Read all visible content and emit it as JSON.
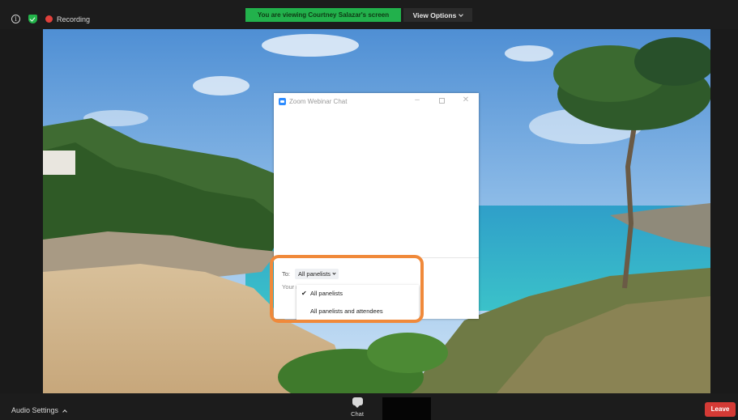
{
  "topbar": {
    "recording_label": "Recording",
    "viewing_banner": "You are viewing Courtney Salazar's screen",
    "view_options_label": "View Options"
  },
  "chat_window": {
    "title": "Zoom Webinar Chat",
    "to_label": "To:",
    "to_selected": "All panelists",
    "input_placeholder": "Your message here...",
    "dropdown_options": [
      {
        "label": "All panelists",
        "checked": true
      },
      {
        "label": "All panelists and attendees",
        "checked": false
      }
    ]
  },
  "bottombar": {
    "audio_settings_label": "Audio Settings",
    "chat_label": "Chat",
    "leave_label": "Leave"
  },
  "colors": {
    "banner_green": "#22b14c",
    "leave_red": "#d43a35",
    "highlight_orange": "#f0893a",
    "zoom_blue": "#2d8cff"
  },
  "icons": [
    "info-icon",
    "shield-check-icon",
    "record-icon",
    "chevron-down-icon",
    "zoom-logo-icon",
    "minimize-icon",
    "maximize-icon",
    "close-icon",
    "checkmark-icon",
    "chevron-up-icon",
    "chat-bubble-icon"
  ]
}
